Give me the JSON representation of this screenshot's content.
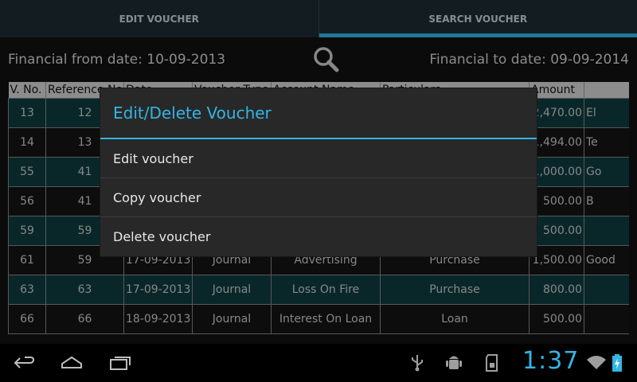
{
  "tabs": [
    {
      "label": "EDIT VOUCHER"
    },
    {
      "label": "SEARCH VOUCHER"
    }
  ],
  "filters": {
    "from_date": "Financial from date: 10-09-2013",
    "to_date": "Financial to date: 09-09-2014"
  },
  "table": {
    "headers": [
      "V. No.",
      "Reference No.",
      "Date",
      "Voucher Type",
      "Account Name",
      "Particulars",
      "Amount",
      ""
    ],
    "rows": [
      {
        "vno": "13",
        "ref": "12",
        "date": "",
        "type": "",
        "account": "",
        "part": "",
        "amount": "2,470.00",
        "extra": "El"
      },
      {
        "vno": "14",
        "ref": "13",
        "date": "",
        "type": "",
        "account": "",
        "part": "",
        "amount": "1,494.00",
        "extra": "Te"
      },
      {
        "vno": "55",
        "ref": "41",
        "date": "",
        "type": "",
        "account": "",
        "part": "",
        "amount": "1,000.00",
        "extra": "Go"
      },
      {
        "vno": "56",
        "ref": "41",
        "date": "",
        "type": "",
        "account": "",
        "part": "",
        "amount": "500.00",
        "extra": "B"
      },
      {
        "vno": "59",
        "ref": "59",
        "date": "",
        "type": "",
        "account": "",
        "part": "",
        "amount": "500.00",
        "extra": ""
      },
      {
        "vno": "61",
        "ref": "59",
        "date": "17-09-2013",
        "type": "Journal",
        "account": "Advertising",
        "part": "Purchase",
        "amount": "1,500.00",
        "extra": "Good"
      },
      {
        "vno": "63",
        "ref": "63",
        "date": "17-09-2013",
        "type": "Journal",
        "account": "Loss On Fire",
        "part": "Purchase",
        "amount": "800.00",
        "extra": ""
      },
      {
        "vno": "66",
        "ref": "66",
        "date": "18-09-2013",
        "type": "Journal",
        "account": "Interest On Loan",
        "part": "Loan",
        "amount": "500.00",
        "extra": ""
      }
    ]
  },
  "dialog": {
    "title": "Edit/Delete Voucher",
    "items": [
      {
        "label": "Edit voucher"
      },
      {
        "label": "Copy voucher"
      },
      {
        "label": "Delete voucher"
      }
    ]
  },
  "statusbar": {
    "time": "1:37",
    "icons": [
      "usb-icon",
      "android-debug-icon",
      "sd-card-icon",
      "wifi-icon",
      "battery-charging-icon"
    ]
  },
  "colors": {
    "accent": "#33b5e5",
    "row_highlight": "#0f3c3f"
  }
}
